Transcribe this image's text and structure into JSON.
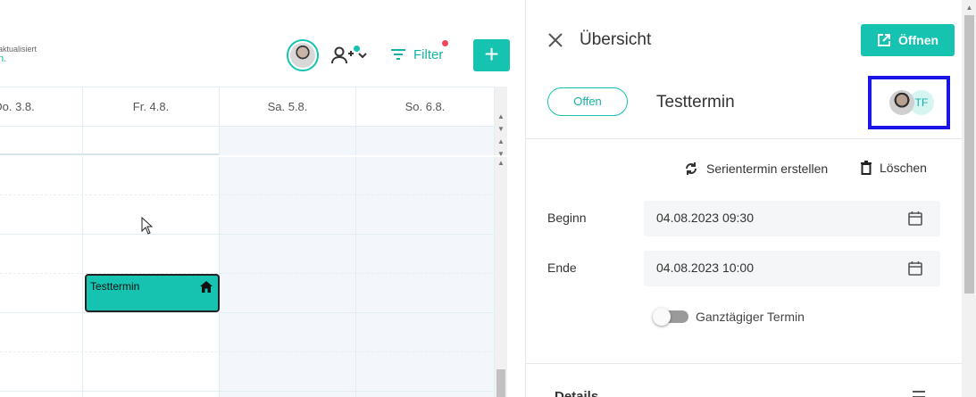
{
  "toolbar": {
    "updated_line1": "aktualisiert",
    "updated_line2": "n.",
    "filter_label": "Filter",
    "add_label": "+"
  },
  "calendar": {
    "days": [
      "Do. 3.8.",
      "Fr. 4.8.",
      "Sa. 5.8.",
      "So. 6.8."
    ],
    "event": {
      "title": "Testtermin",
      "icon": "home-icon"
    }
  },
  "panel": {
    "title": "Übersicht",
    "open_label": "Öffnen",
    "status": "Offen",
    "event_name": "Testtermin",
    "attendee_initials": "TF",
    "series_label": "Serientermin erstellen",
    "delete_label": "Löschen",
    "begin_label": "Beginn",
    "begin_value": "04.08.2023 09:30",
    "end_label": "Ende",
    "end_value": "04.08.2023 10:00",
    "allday_label": "Ganztägiger Termin",
    "details_label": "Details"
  },
  "colors": {
    "accent": "#16c2b0",
    "highlight_border": "#1a14e6",
    "notification_red": "#f0455a"
  }
}
